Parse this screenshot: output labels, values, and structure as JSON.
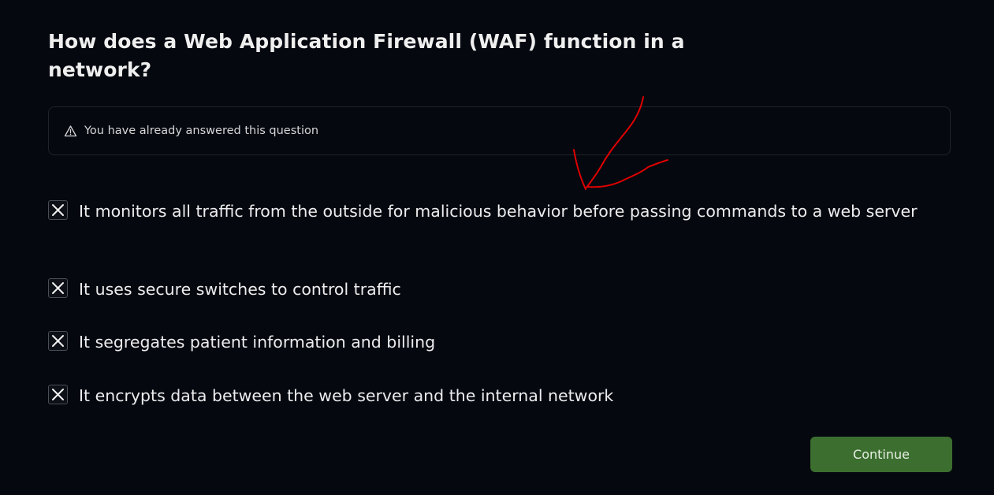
{
  "question": {
    "title": "How does a Web Application Firewall (WAF) function in a network?"
  },
  "notice": {
    "icon": "warning-icon",
    "text": "You have already answered this question"
  },
  "options": [
    {
      "label": "It monitors all traffic from the outside for malicious behavior before passing commands to a web server",
      "state": "incorrect-mark"
    },
    {
      "label": "It uses secure switches to control traffic",
      "state": "incorrect-mark"
    },
    {
      "label": "It segregates patient information and billing",
      "state": "incorrect-mark"
    },
    {
      "label": "It encrypts data between the web server and the internal network",
      "state": "incorrect-mark"
    }
  ],
  "footer": {
    "continue_label": "Continue"
  },
  "colors": {
    "background": "#05080f",
    "continue_button": "#3b6e2f",
    "annotation_stroke": "#e00000"
  }
}
